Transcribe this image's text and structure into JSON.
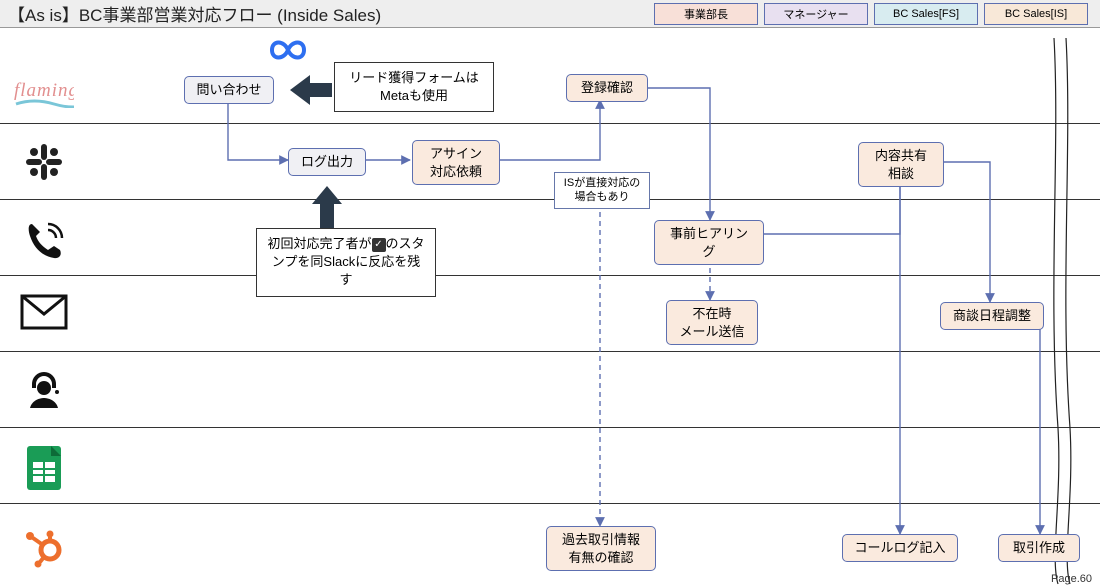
{
  "title": "【As is】BC事業部営業対応フロー (Inside Sales)",
  "legend": {
    "l1": "事業部長",
    "l2": "マネージャー",
    "l3": "BC Sales[FS]",
    "l4": "BC Sales[IS]"
  },
  "nodes": {
    "inquiry": "問い合わせ",
    "meta_note": "リード獲得フォームはMetaも使用",
    "log_out": "ログ出力",
    "assign": "アサイン\n対応依頼",
    "slack_note": "初回対応完了者が ✔ のスタンプを同Slackに反応を残す",
    "is_note": "ISが直接対応の場合もあり",
    "reg_confirm": "登録確認",
    "pre_hearing": "事前ヒアリング",
    "absent_mail": "不在時\nメール送信",
    "share": "内容共有\n相談",
    "schedule": "商談日程調整",
    "past_deal": "過去取引情報\n有無の確認",
    "call_log": "コールログ記入",
    "deal_create": "取引作成"
  },
  "page": "Page.60"
}
